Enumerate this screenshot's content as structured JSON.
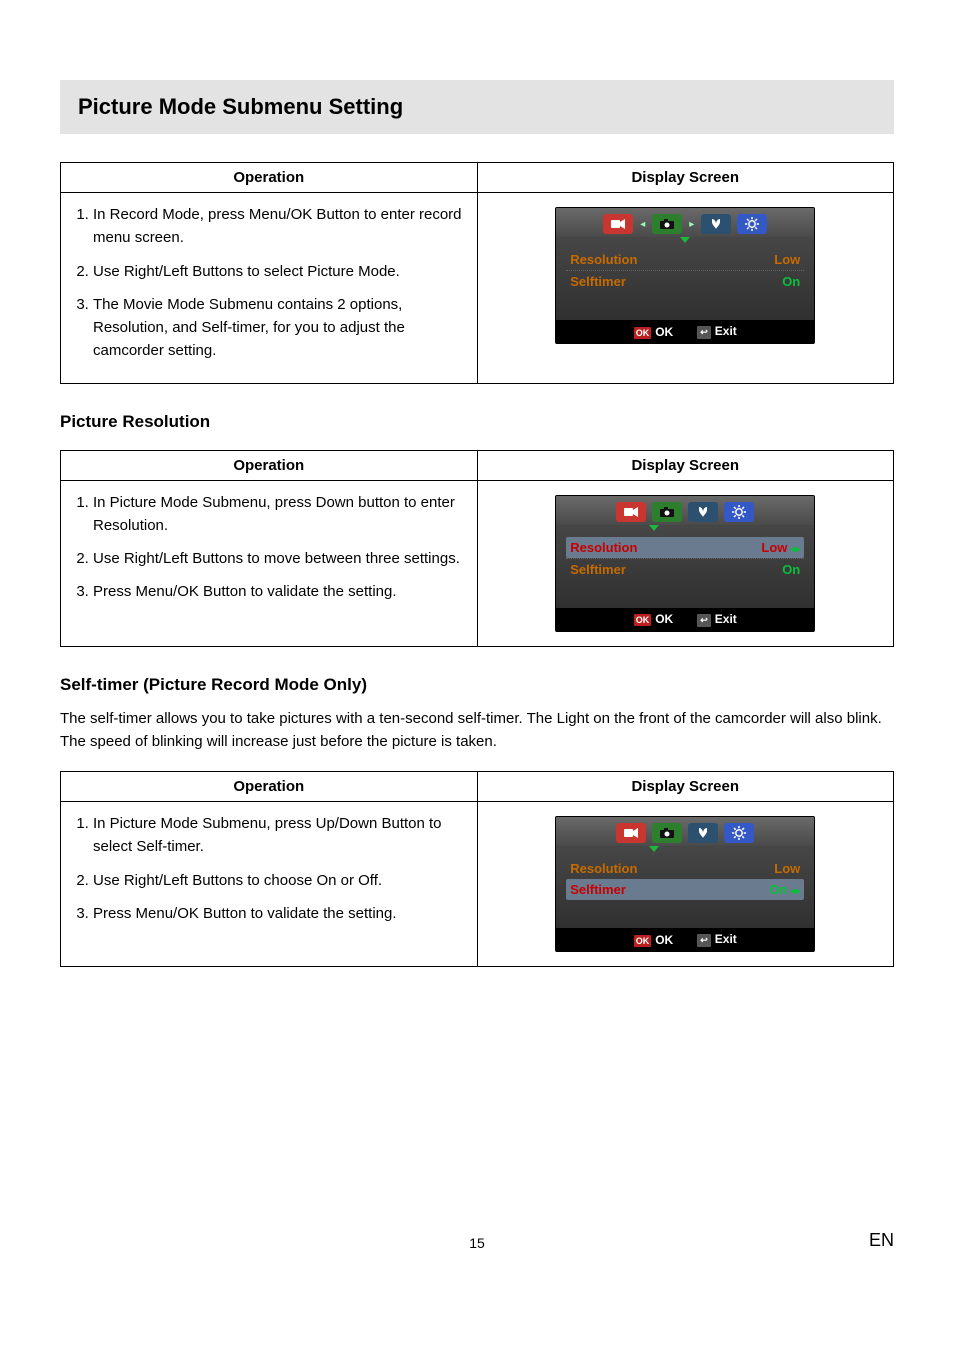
{
  "sectionTitle": "Picture Mode Submenu Setting",
  "table1": {
    "hOperation": "Operation",
    "hDisplay": "Display Screen",
    "step1": "In Record Mode, press Menu/OK Button to enter record menu screen.",
    "step2": "Use Right/Left Buttons to select Picture Mode.",
    "step3": "The Movie Mode Submenu contains 2 options, Resolution, and Self-timer, for you to adjust the camcorder setting."
  },
  "screen1": {
    "row1Label": "Resolution",
    "row1Value": "Low",
    "row2Label": "Selftimer",
    "row2Value": "On",
    "ok": "OK",
    "exit": "Exit"
  },
  "heading2": "Picture Resolution",
  "table2": {
    "hOperation": "Operation",
    "hDisplay": "Display Screen",
    "step1": "In Picture Mode Submenu, press Down button to enter Resolution.",
    "step2": "Use Right/Left Buttons to move between three settings.",
    "step3": "Press Menu/OK Button to validate the setting."
  },
  "screen2": {
    "row1Label": "Resolution",
    "row1Value": "Low",
    "row2Label": "Selftimer",
    "row2Value": "On",
    "ok": "OK",
    "exit": "Exit"
  },
  "heading3": "Self-timer (Picture Record Mode Only)",
  "desc3": "The self-timer allows you to take pictures with a ten-second self-timer. The Light on the front of the camcorder will also blink. The speed of blinking will increase just before the picture is taken.",
  "table3": {
    "hOperation": "Operation",
    "hDisplay": "Display Screen",
    "step1": "In Picture Mode Submenu, press Up/Down Button to select Self-timer.",
    "step2": "Use Right/Left Buttons to choose On or Off.",
    "step3": "Press Menu/OK Button to validate the setting."
  },
  "screen3": {
    "row1Label": "Resolution",
    "row1Value": "Low",
    "row2Label": "Selftimer",
    "row2Value": "On",
    "ok": "OK",
    "exit": "Exit"
  },
  "pageNumber": "15",
  "pageLang": "EN"
}
